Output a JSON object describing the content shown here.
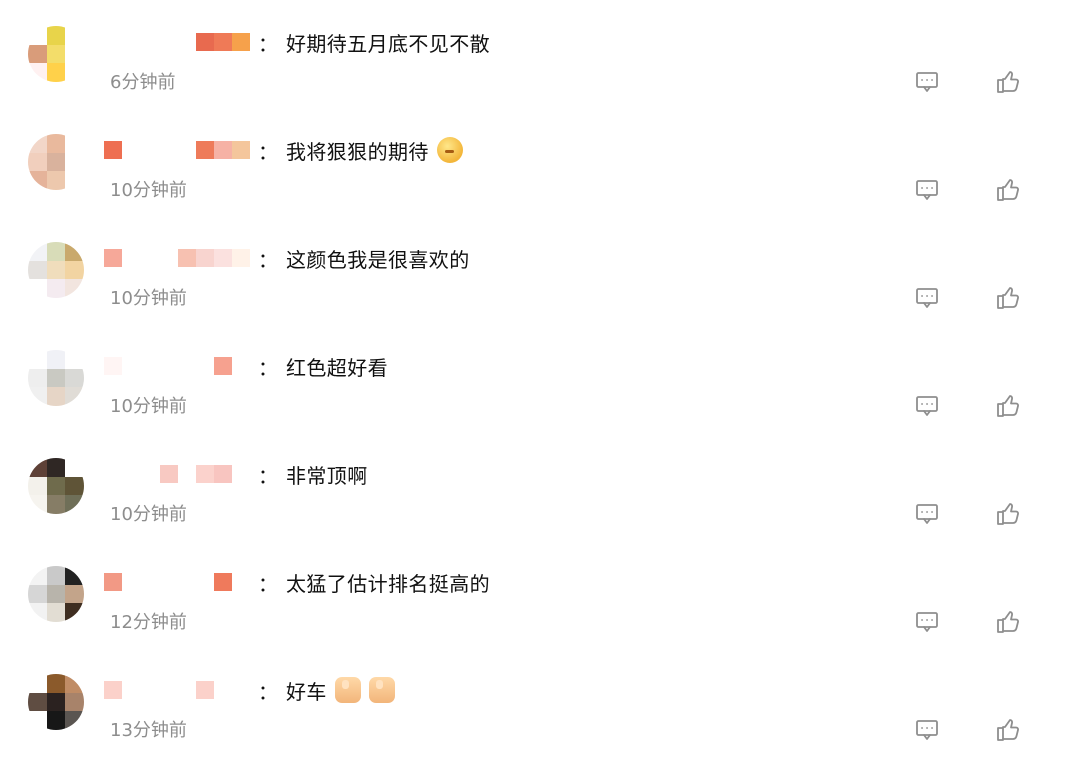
{
  "comments": [
    {
      "content": "好期待五月底不见不散",
      "time": "6分钟前",
      "emoji": "",
      "avatar_colors": [
        "#ffffff",
        "#e8d44a",
        "#ffffff",
        "#d99c7a",
        "#f3dd6a",
        "#ffffff",
        "#fff1f1",
        "#ffd14a",
        "#ffffff"
      ],
      "name_colors": [
        "#ffffff",
        "#ffffff",
        "#ffffff",
        "#e86a4f",
        "#ef7a57",
        "#f6a14b",
        "#f4a520"
      ],
      "accent_color": "#f08b57"
    },
    {
      "content": "我将狠狠的期待",
      "time": "10分钟前",
      "emoji": "🤔",
      "avatar_colors": [
        "#f2d6c8",
        "#e9b99d",
        "#ffffff",
        "#f1cfbd",
        "#d9b29d",
        "#ffffff",
        "#e5b39a",
        "#edc8ad",
        "#ffffff"
      ],
      "name_colors": [
        "#ee6f52",
        "#ffffff",
        "#ffffff",
        "#ee7b5a",
        "#f6b2a5",
        "#f4c69c",
        "#f0d56a"
      ],
      "accent_color": "#f08b57"
    },
    {
      "content": "这颜色我是很喜欢的",
      "time": "10分钟前",
      "emoji": "",
      "avatar_colors": [
        "#f2f3f6",
        "#d8dcb8",
        "#c9a96c",
        "#e4e1de",
        "#f0ddbc",
        "#f2d4a2",
        "#ffffff",
        "#f4ebf0",
        "#f2e5df"
      ],
      "name_colors": [
        "#f6a899",
        "#ffffff",
        "#f7c1b1",
        "#f8d4cf",
        "#fbe1df",
        "#fff2e8",
        "#f8d66b"
      ],
      "accent_color": "#f3b1a0"
    },
    {
      "content": "红色超好看",
      "time": "10分钟前",
      "emoji": "",
      "avatar_colors": [
        "#ffffff",
        "#f0f1f6",
        "#ffffff",
        "#eeeeee",
        "#c9c9c2",
        "#d9d9d6",
        "#f0f0f0",
        "#e6d5c6",
        "#e0dcd6"
      ],
      "name_colors": [
        "#fff5f4",
        "#ffffff",
        "#ffffff",
        "#ffffff",
        "#f6a18f",
        "#ffffff",
        "#ffffff"
      ],
      "accent_color": "#f6a18f"
    },
    {
      "content": "非常顶啊",
      "time": "10分钟前",
      "emoji": "",
      "avatar_colors": [
        "#5e4137",
        "#2f2724",
        "#ffffff",
        "#f3f1eb",
        "#6f6b4c",
        "#5f5437",
        "#f6f4ef",
        "#867d66",
        "#6f6f58"
      ],
      "name_colors": [
        "#ffffff",
        "#f8c9c2",
        "#ffffff",
        "#fbd2cc",
        "#f8c5c0",
        "#ffffff",
        "#ffffff"
      ],
      "accent_color": "#f8c5c0"
    },
    {
      "content": "太猛了估计排名挺高的",
      "time": "12分钟前",
      "emoji": "",
      "avatar_colors": [
        "#f3f3f3",
        "#c9c9c9",
        "#222222",
        "#d6d6d6",
        "#b8b4ab",
        "#c3a48a",
        "#f2f2f2",
        "#e2ddd3",
        "#3f2e21"
      ],
      "name_colors": [
        "#f29985",
        "#ffffff",
        "#ffffff",
        "#ffffff",
        "#ef7a5c",
        "#ffffff",
        "#ffffff"
      ],
      "accent_color": "#f27a5a"
    },
    {
      "content": "好车",
      "time": "13分钟前",
      "emoji": "👍👍",
      "avatar_colors": [
        "#ffffff",
        "#8b5a2b",
        "#c08c65",
        "#5f4d42",
        "#2b2220",
        "#a8836a",
        "#ffffff",
        "#171717",
        "#5a5551"
      ],
      "name_colors": [
        "#fbd1ca",
        "#ffffff",
        "#ffffff",
        "#fbd1ca",
        "#ffffff",
        "#ffffff",
        "#ffffff"
      ],
      "accent_color": "#fbd1ca"
    }
  ],
  "icons": {
    "reply": "reply-icon",
    "like": "like-icon"
  },
  "colors": {
    "text": "#111111",
    "time": "#8d8d8d",
    "icon": "#8e8e8e"
  }
}
